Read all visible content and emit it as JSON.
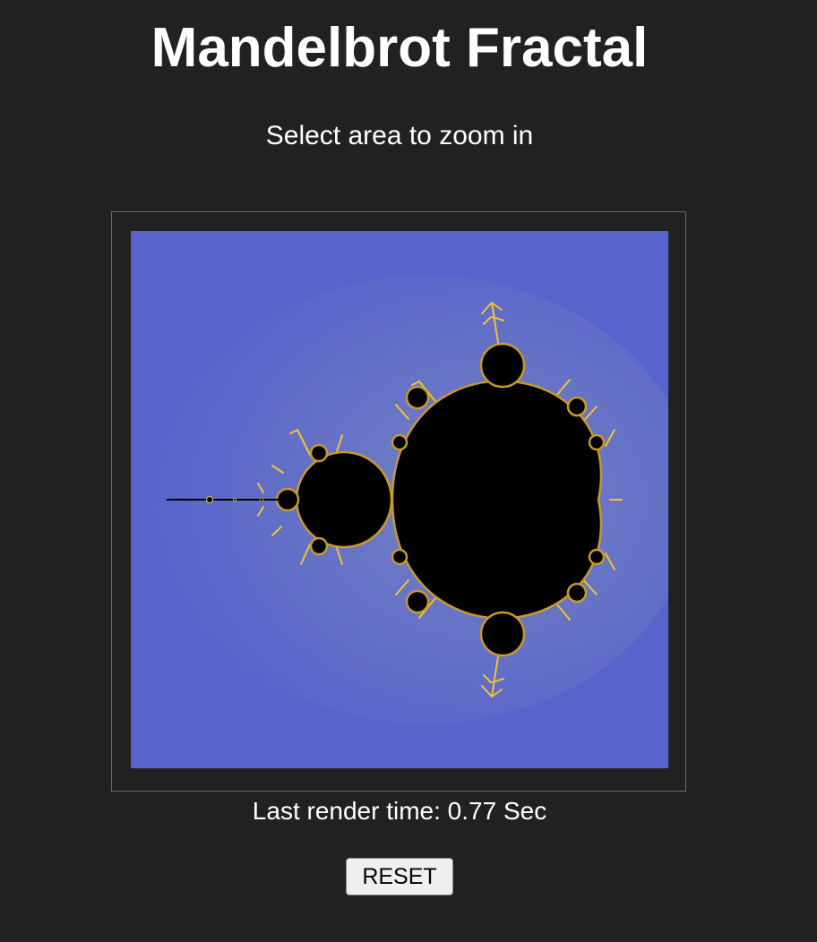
{
  "page": {
    "title": "Mandelbrot Fractal",
    "subtitle": "Select area to zoom in"
  },
  "fractal": {
    "background_color": "#5863cc",
    "halo_color": "#6a7ac8",
    "set_color": "#000000",
    "edge_color": "#f1c232"
  },
  "status": {
    "render_time": "Last render time: 0.77 Sec"
  },
  "controls": {
    "reset_label": "RESET"
  }
}
